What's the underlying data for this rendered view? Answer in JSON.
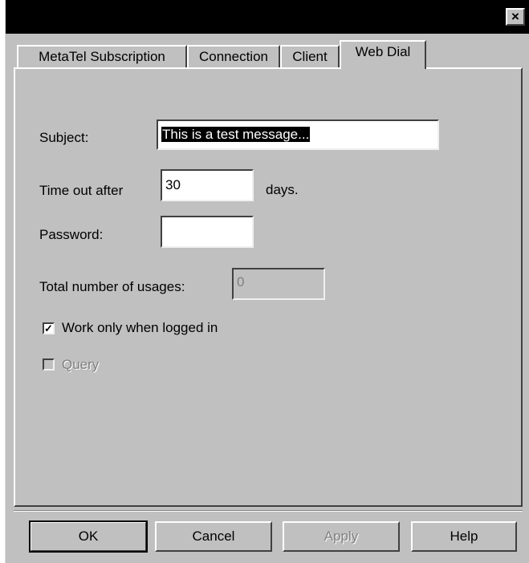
{
  "window": {
    "close_glyph": "×"
  },
  "tabs": [
    {
      "label": "MetaTel Subscription"
    },
    {
      "label": "Connection"
    },
    {
      "label": "Client"
    },
    {
      "label": "Web Dial",
      "active": true
    }
  ],
  "form": {
    "subject_label": "Subject:",
    "subject_value": "This is a test message...",
    "timeout_label": "Time out after",
    "timeout_value": "30",
    "timeout_unit": "days.",
    "password_label": "Password:",
    "password_value": "",
    "usages_label": "Total number of usages:",
    "usages_value": "0",
    "work_logged_in_label": "Work only when logged in",
    "work_logged_in_checked": true,
    "work_logged_in_mark": "✓",
    "query_label": "Query",
    "query_checked": false
  },
  "buttons": {
    "ok": "OK",
    "cancel": "Cancel",
    "apply": "Apply",
    "help": "Help"
  }
}
